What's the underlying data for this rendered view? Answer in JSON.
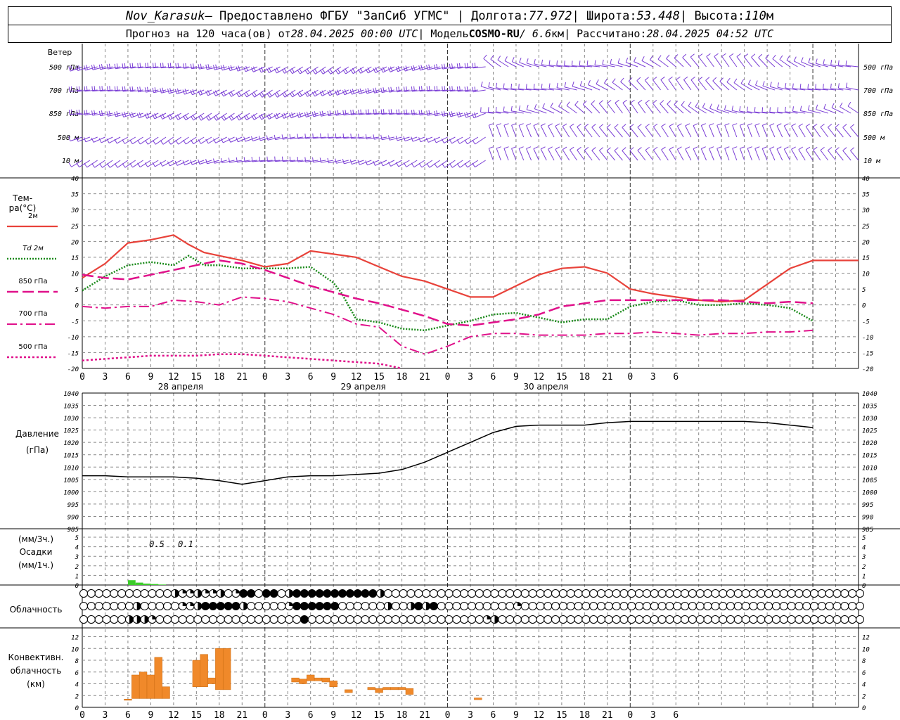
{
  "header": {
    "station": "Nov_Karasuk",
    "provider": " – Предоставлено ФГБУ \"ЗапСиб УГМС\" | Долгота: ",
    "lon": "77.972",
    "lat_label": " | Широта: ",
    "lat": "53.448",
    "alt_label": " | Высота: ",
    "alt": "110",
    "alt_unit": "м",
    "forecast_label": "Прогноз на 120 часа(ов) от ",
    "forecast_time": "28.04.2025 00:00 UTC",
    "model_label": "  | Модель ",
    "model": "COSMO-RU",
    "res": " / 6.6",
    "res_unit": "км",
    "calc_label": " | Рассчитано: ",
    "calc_time": "28.04.2025 04:52 UTC"
  },
  "labels": {
    "wind": "Ветер",
    "wind_levels": [
      "500 гПа",
      "700 гПа",
      "850 гПа",
      "500 м",
      "10  м"
    ],
    "temp_title": "Тем-ра(°С)",
    "legend": [
      "2м",
      "Td 2м",
      "850 гПа",
      "700 гПа",
      "500 гПа"
    ],
    "pressure_title": "Давление",
    "pressure_unit": "(гПа)",
    "precip_unit_top": "(мм/3ч.)",
    "precip_title": "Осадки",
    "precip_unit_bottom": "(мм/1ч.)",
    "precip_annotations": [
      "0.5",
      "0.1"
    ],
    "cloud_title": "Облачность",
    "conv_title_1": "Конвективн.",
    "conv_title_2": "облачность",
    "conv_unit": "(км)",
    "days": [
      "28 апреля",
      "29 апреля",
      "30 апреля"
    ],
    "hour_ticks": [
      "0",
      "3",
      "6",
      "9",
      "12",
      "15",
      "18",
      "21",
      "0",
      "3",
      "6",
      "9",
      "12",
      "15",
      "18",
      "21",
      "0",
      "3",
      "6",
      "9",
      "12",
      "15",
      "18",
      "21",
      "0",
      "3",
      "6"
    ]
  },
  "colors": {
    "wind": "#7b3fd6",
    "t2m": "#e8423a",
    "td2m": "#1a8a1a",
    "t850": "#e0108a",
    "precip": "#3ccc2a",
    "conv": "#f0892a",
    "grid": "#888888"
  },
  "chart_data": [
    {
      "type": "line",
      "title": "Тем-ра(°С)",
      "ylim": [
        -20,
        40
      ],
      "x_unit": "hours from 28.04.2025 00:00 UTC",
      "series": [
        {
          "name": "2м",
          "x": [
            0,
            3,
            6,
            9,
            12,
            14,
            16,
            18,
            21,
            24,
            27,
            30,
            33,
            36,
            39,
            42,
            45,
            48,
            51,
            54,
            57,
            60,
            63,
            66,
            69,
            72,
            75,
            78,
            81,
            84,
            87,
            90,
            93,
            96,
            99,
            102
          ],
          "values": [
            8.5,
            13,
            19.5,
            20.5,
            22,
            19,
            16.5,
            15.5,
            14,
            12,
            13,
            17,
            16,
            15,
            12,
            9,
            7.5,
            5,
            2.5,
            2.5,
            6,
            9.5,
            11.5,
            12,
            10,
            5,
            3.5,
            2.5,
            1.5,
            1,
            1.5,
            6.5,
            11.5,
            14,
            14,
            14
          ]
        },
        {
          "name": "Td 2м",
          "x": [
            0,
            3,
            6,
            9,
            12,
            14,
            16,
            18,
            21,
            24,
            27,
            30,
            33,
            34,
            36,
            39,
            42,
            45,
            48,
            51,
            54,
            57,
            60,
            63,
            66,
            69,
            72,
            75,
            78,
            81,
            84,
            87,
            90,
            93,
            96
          ],
          "values": [
            4.5,
            9,
            12.5,
            13.5,
            12.5,
            15.5,
            12.5,
            12.5,
            11.5,
            11.5,
            11.5,
            12,
            7,
            4,
            -4.5,
            -5.5,
            -7.5,
            -8,
            -6.5,
            -5,
            -3,
            -2.5,
            -4,
            -5.5,
            -4.5,
            -4.5,
            -0.5,
            1,
            1.5,
            0,
            0,
            0.5,
            0,
            -1,
            -5
          ]
        },
        {
          "name": "850 гПа",
          "x": [
            0,
            3,
            6,
            9,
            12,
            15,
            18,
            21,
            24,
            27,
            30,
            33,
            36,
            39,
            42,
            45,
            48,
            51,
            54,
            57,
            60,
            63,
            66,
            69,
            72,
            75,
            78,
            81,
            84,
            87,
            90,
            93,
            96
          ],
          "values": [
            9.5,
            8.5,
            8,
            9.5,
            11,
            12.5,
            14,
            13,
            11,
            8.5,
            6,
            4,
            2,
            0.5,
            -1.5,
            -3.5,
            -6,
            -6.5,
            -5.5,
            -4.5,
            -3,
            -0.5,
            0.5,
            1.5,
            1.5,
            1.5,
            1.5,
            1.5,
            1.5,
            1,
            0.5,
            1,
            0.5
          ]
        },
        {
          "name": "700 гПа",
          "x": [
            0,
            3,
            6,
            9,
            12,
            15,
            18,
            21,
            24,
            27,
            30,
            33,
            36,
            39,
            42,
            45,
            48,
            51,
            54,
            57,
            60,
            63,
            66,
            69,
            72,
            75,
            78,
            81,
            84,
            87,
            90,
            93,
            96
          ],
          "values": [
            -0.5,
            -1,
            -0.5,
            -0.5,
            1.5,
            1,
            0,
            2.5,
            2,
            1,
            -1,
            -3,
            -6,
            -7,
            -13,
            -15.5,
            -13,
            -10,
            -9,
            -9,
            -9.5,
            -9.5,
            -9.5,
            -9,
            -9,
            -8.5,
            -9,
            -9.5,
            -9,
            -9,
            -8.5,
            -8.5,
            -8
          ]
        },
        {
          "name": "500 гПа",
          "x": [
            0,
            3,
            6,
            9,
            12,
            15,
            18,
            21,
            24,
            27,
            30,
            33,
            36,
            39,
            42
          ],
          "values": [
            -17.5,
            -17,
            -16.5,
            -16,
            -16,
            -16,
            -15.5,
            -15.5,
            -16,
            -16.5,
            -17,
            -17.5,
            -18,
            -18.5,
            -20
          ]
        }
      ]
    },
    {
      "type": "line",
      "title": "Давление",
      "ylabel": "(гПа)",
      "ylim": [
        985,
        1040
      ],
      "series": [
        {
          "x": [
            0,
            3,
            6,
            9,
            12,
            15,
            18,
            21,
            24,
            27,
            30,
            33,
            36,
            39,
            42,
            45,
            48,
            51,
            54,
            57,
            60,
            63,
            66,
            69,
            72,
            75,
            78,
            81,
            84,
            87,
            90,
            93,
            96
          ],
          "values": [
            1006.5,
            1006.5,
            1006,
            1006,
            1006,
            1005.5,
            1004.5,
            1003,
            1004.5,
            1006,
            1006.5,
            1006.5,
            1007,
            1007.5,
            1009,
            1012,
            1016,
            1020,
            1024,
            1026.5,
            1027,
            1027,
            1027,
            1028,
            1028.5,
            1028.5,
            1028.5,
            1028.5,
            1028.5,
            1028.5,
            1028,
            1027,
            1026
          ]
        }
      ]
    },
    {
      "type": "bar",
      "title": "Осадки",
      "ylim": [
        0,
        5
      ],
      "series": [
        {
          "x": [
            7,
            8,
            9,
            10,
            11
          ],
          "values": [
            0.5,
            0.25,
            0.15,
            0.1,
            0.05
          ]
        }
      ]
    },
    {
      "type": "bar",
      "title": "Конвективн. облачность",
      "ylabel": "(км)",
      "ylim": [
        0,
        12
      ],
      "bars": [
        {
          "x": 6,
          "base": 1.2,
          "top": 1.4
        },
        {
          "x": 7,
          "base": 1.5,
          "top": 5.5
        },
        {
          "x": 8,
          "base": 1.5,
          "top": 6
        },
        {
          "x": 9,
          "base": 1.5,
          "top": 5.5
        },
        {
          "x": 10,
          "base": 1.5,
          "top": 8.5
        },
        {
          "x": 11,
          "base": 1.5,
          "top": 3.5
        },
        {
          "x": 15,
          "base": 3.5,
          "top": 8
        },
        {
          "x": 16,
          "base": 3.5,
          "top": 9
        },
        {
          "x": 17,
          "base": 4,
          "top": 5
        },
        {
          "x": 18,
          "base": 3,
          "top": 10
        },
        {
          "x": 19,
          "base": 3,
          "top": 10
        },
        {
          "x": 28,
          "base": 4.3,
          "top": 5
        },
        {
          "x": 29,
          "base": 4,
          "top": 4.8
        },
        {
          "x": 30,
          "base": 4.5,
          "top": 5.5
        },
        {
          "x": 31,
          "base": 4.5,
          "top": 5
        },
        {
          "x": 32,
          "base": 4.3,
          "top": 5
        },
        {
          "x": 33,
          "base": 3.5,
          "top": 4.5
        },
        {
          "x": 35,
          "base": 2.5,
          "top": 3
        },
        {
          "x": 38,
          "base": 3,
          "top": 3.4
        },
        {
          "x": 39,
          "base": 2.5,
          "top": 3.2
        },
        {
          "x": 40,
          "base": 3,
          "top": 3.4
        },
        {
          "x": 41,
          "base": 3,
          "top": 3.4
        },
        {
          "x": 42,
          "base": 3,
          "top": 3.4
        },
        {
          "x": 43,
          "base": 2.2,
          "top": 3.2
        },
        {
          "x": 52,
          "base": 1.3,
          "top": 1.6
        }
      ]
    }
  ]
}
